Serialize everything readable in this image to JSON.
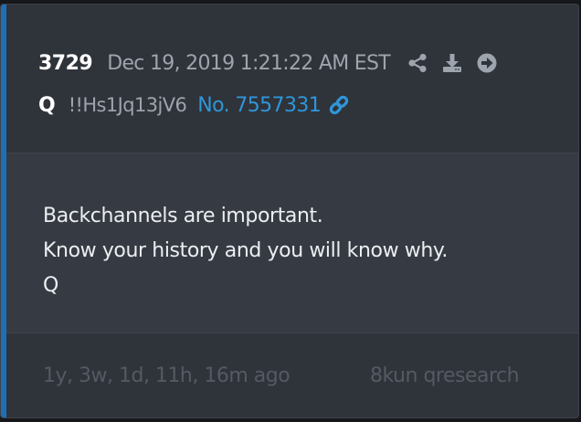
{
  "post": {
    "number": "3729",
    "date": "Dec 19, 2019 1:21:22 AM EST",
    "author": "Q",
    "tripcode": "!!Hs1Jq13jV6",
    "post_link": "No. 7557331",
    "message_lines": [
      "Backchannels are important.",
      "Know your history and you will know why.",
      "Q"
    ],
    "time_ago": "1y, 3w, 1d, 11h, 16m ago",
    "source": "8kun qresearch"
  },
  "icons": {
    "share": "share-icon",
    "download": "download-icon",
    "open": "arrow-circle-right-icon",
    "link": "link-icon"
  },
  "colors": {
    "card_bg": "#2f333a",
    "body_bg": "#363b43",
    "accent": "#1f6fb5",
    "link": "#2f96d8",
    "muted": "#9ea4ad",
    "footer_text": "#545a63"
  }
}
